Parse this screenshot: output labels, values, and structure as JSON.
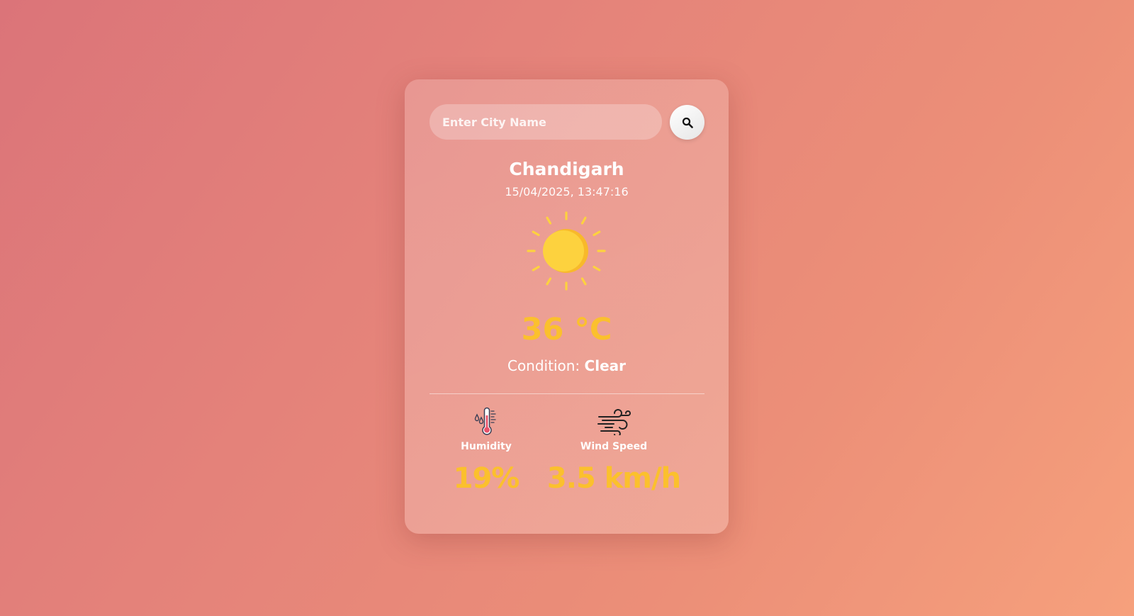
{
  "search": {
    "placeholder": "Enter City Name",
    "value": "",
    "button_icon": "search-icon"
  },
  "weather": {
    "city": "Chandigarh",
    "datetime": "15/04/2025, 13:47:16",
    "icon": "sun-icon",
    "temperature": "36 °C",
    "condition_label": "Condition:",
    "condition_value": "Clear"
  },
  "stats": {
    "humidity": {
      "icon": "thermometer-humidity-icon",
      "label": "Humidity",
      "value": "19%"
    },
    "wind": {
      "icon": "wind-icon",
      "label": "Wind Speed",
      "value": "3.5 km/h"
    }
  },
  "colors": {
    "background_start": "#db7479",
    "background_end": "#f6a07c",
    "accent": "#fbc02d",
    "sun": "#fdd23e"
  }
}
